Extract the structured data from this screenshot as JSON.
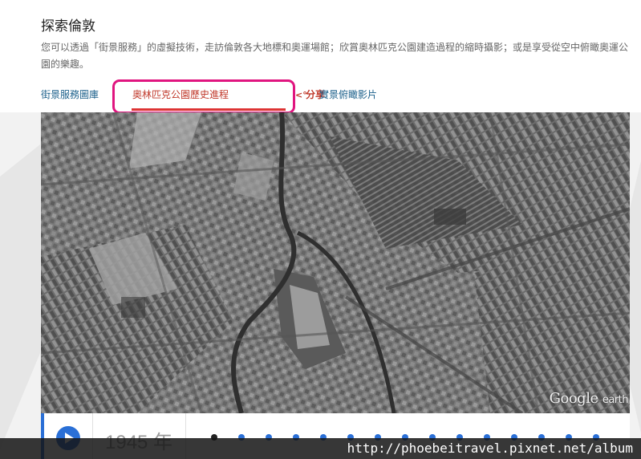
{
  "page": {
    "title": "探索倫敦",
    "description": "您可以透過「街景服務」的虛擬技術，走訪倫敦各大地標和奧運場館；欣賞奧林匹克公園建造過程的縮時攝影；或是享受從空中俯瞰奧運公園的樂趣。"
  },
  "tabs": [
    {
      "label": "街景服務圖庫",
      "active": false
    },
    {
      "label": "奧林匹克公園歷史進程",
      "active": true
    },
    {
      "label": "實景俯瞰影片",
      "active": false
    }
  ],
  "share": {
    "label": "分享",
    "icon": "share-icon"
  },
  "map": {
    "brand": "Google",
    "brand_suffix": "earth"
  },
  "timeline": {
    "year": "1945 年",
    "dots_count": 15,
    "current_index": 0,
    "accent": "#2a6fd6"
  },
  "watermark": {
    "text": "http://phoebeitravel.pixnet.net/album"
  },
  "colors": {
    "highlight": "#e0157f",
    "active_tab": "#c0392b",
    "link": "#1a5f8a"
  }
}
